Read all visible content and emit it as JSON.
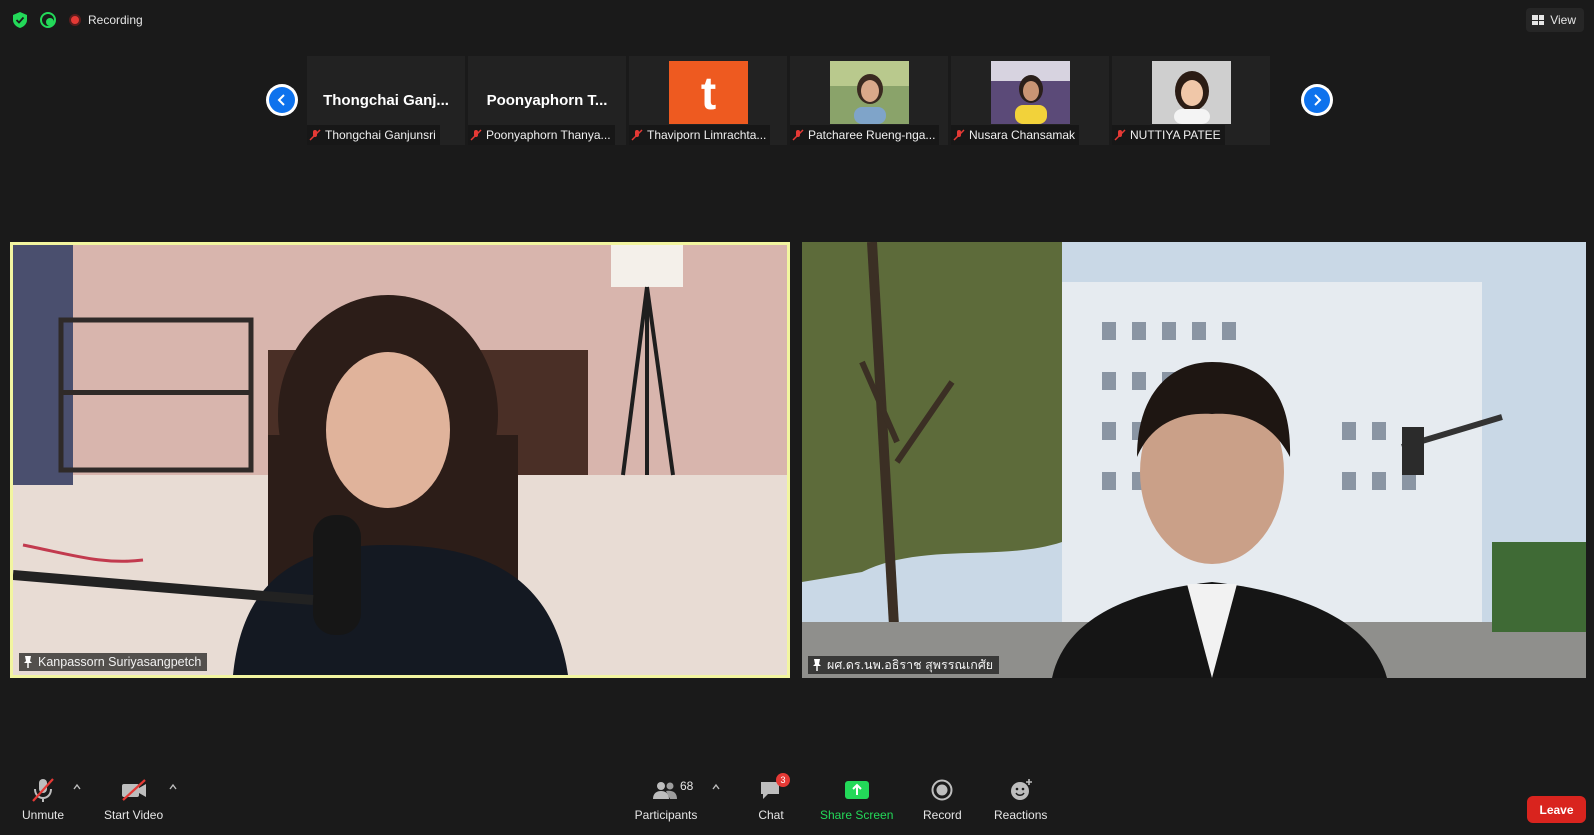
{
  "topbar": {
    "recording_label": "Recording",
    "view_label": "View"
  },
  "thumbnails": [
    {
      "big_name": "Thongchai  Ganj...",
      "label": "Thongchai Ganjunsri",
      "avatar": "none"
    },
    {
      "big_name": "Poonyaphorn  T...",
      "label": "Poonyaphorn Thanya...",
      "avatar": "none"
    },
    {
      "big_name": "",
      "label": "Thaviporn Limrachta...",
      "avatar": "letter",
      "letter": "t",
      "color": "#ee5a20"
    },
    {
      "big_name": "",
      "label": "Patcharee Rueng-nga...",
      "avatar": "photo"
    },
    {
      "big_name": "",
      "label": "Nusara Chansamak",
      "avatar": "photo"
    },
    {
      "big_name": "",
      "label": "NUTTIYA PATEE",
      "avatar": "photo"
    }
  ],
  "main_tiles": [
    {
      "name": "Kanpassorn Suriyasangpetch",
      "active_speaker": true,
      "border_color": "#f2f5a0"
    },
    {
      "name": "ผศ.ดร.นพ.อธิราช สุพรรณเกศัย",
      "active_speaker": false
    }
  ],
  "toolbar": {
    "unmute": "Unmute",
    "start_video": "Start Video",
    "participants": "Participants",
    "participants_count": "68",
    "chat": "Chat",
    "chat_badge": "3",
    "share_screen": "Share Screen",
    "record": "Record",
    "reactions": "Reactions",
    "leave": "Leave"
  },
  "colors": {
    "background": "#1a1a1a",
    "accent_blue": "#0e72ed",
    "share_green": "#23d959",
    "leave_red": "#d9241e",
    "active_speaker": "#f2f5a0"
  }
}
